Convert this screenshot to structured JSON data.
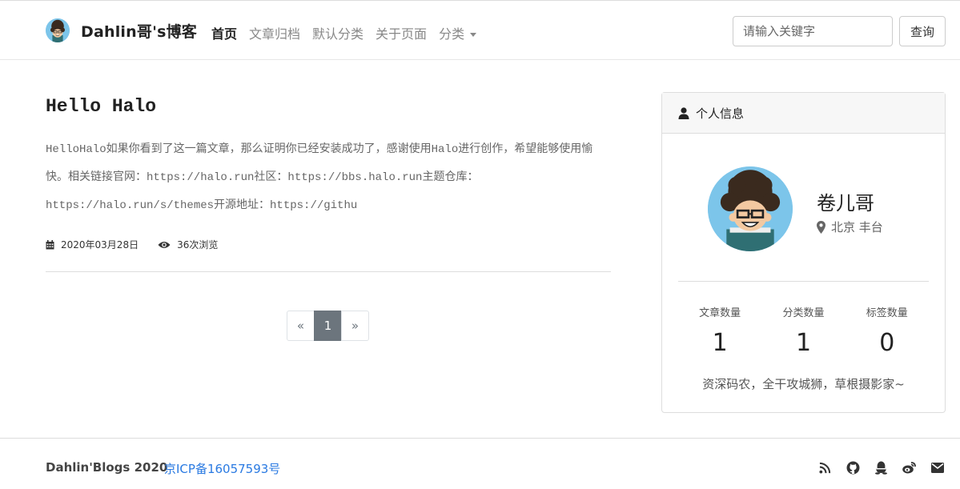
{
  "header": {
    "site_title": "Dahlin哥's博客",
    "nav": [
      {
        "label": "首页",
        "active": true
      },
      {
        "label": "文章归档"
      },
      {
        "label": "默认分类"
      },
      {
        "label": "关于页面"
      },
      {
        "label": "分类"
      }
    ],
    "search_placeholder": "请输入关键字",
    "search_button": "查询"
  },
  "post": {
    "title": "Hello Halo",
    "excerpt": "HelloHalo如果你看到了这一篇文章，那么证明你已经安装成功了，感谢使用Halo进行创作，希望能够使用愉快。相关链接官网：https://halo.run社区：https://bbs.halo.run主题仓库：https://halo.run/s/themes开源地址：https://githu",
    "date": "2020年03月28日",
    "views": "36次浏览"
  },
  "pagination": {
    "prev": "«",
    "current": "1",
    "next": "»"
  },
  "sidebar": {
    "header": "个人信息",
    "name": "卷儿哥",
    "location": "北京 丰台",
    "stats": [
      {
        "label": "文章数量",
        "value": "1"
      },
      {
        "label": "分类数量",
        "value": "1"
      },
      {
        "label": "标签数量",
        "value": "0"
      }
    ],
    "bio": "资深码农，全干攻城狮，草根摄影家~"
  },
  "footer": {
    "copyright": "Dahlin'Blogs 2020",
    "icp": "京ICP备16057593号",
    "icons": [
      "rss-icon",
      "github-icon",
      "qq-icon",
      "weibo-icon",
      "email-icon"
    ]
  },
  "colors": {
    "link": "#2a7ae2",
    "active_page": "#6c757d",
    "avatar_bg": "#7cc5ea"
  }
}
